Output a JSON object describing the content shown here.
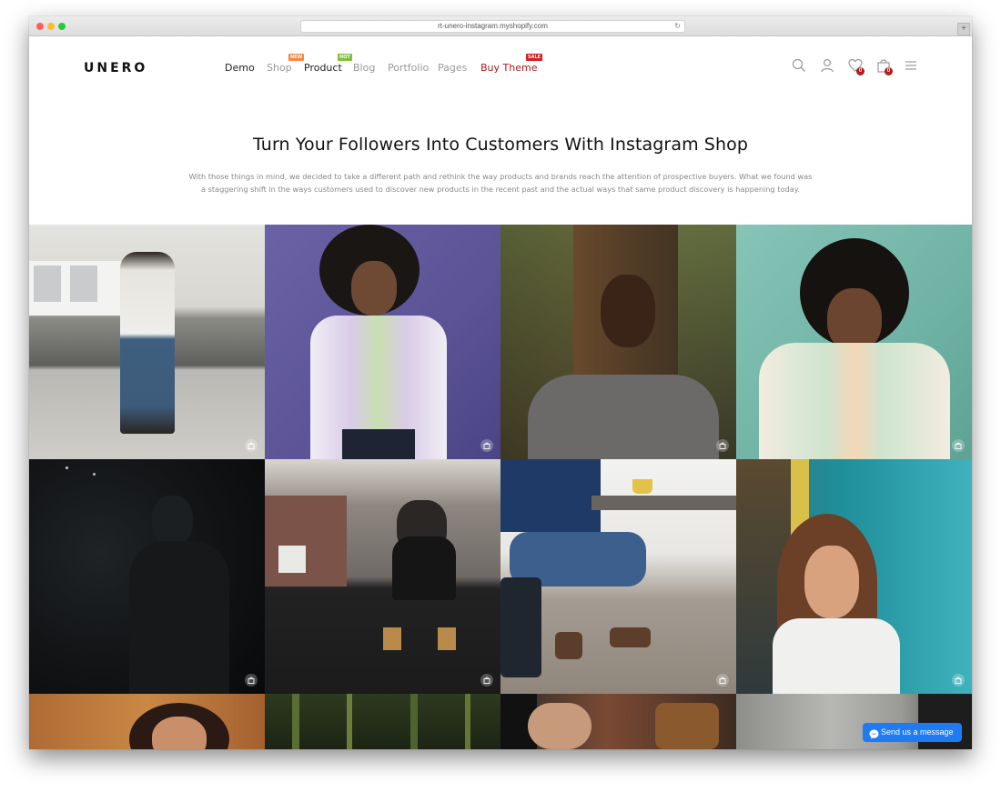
{
  "browser": {
    "url": "rt-unero-instagram.myshopify.com"
  },
  "header": {
    "logo": "UNERO",
    "nav": [
      {
        "label": "Demo"
      },
      {
        "label": "Shop",
        "badge": "NEW"
      },
      {
        "label": "Product",
        "badge": "HOT"
      },
      {
        "label": "Blog"
      },
      {
        "label": "Portfolio"
      },
      {
        "label": "Pages"
      },
      {
        "label": "Buy Theme",
        "badge": "SALE"
      }
    ],
    "wishlist_count": "0",
    "cart_count": "0",
    "icons": [
      "search-icon",
      "account-icon",
      "heart-icon",
      "bag-icon",
      "menu-icon"
    ]
  },
  "hero": {
    "title": "Turn Your Followers Into Customers With Instagram Shop",
    "text": "With those things in mind, we decided to take a different path and rethink the way products and brands reach the attention of prospective buyers. What we found was a staggering shift in the ways customers used to discover new products in the recent past and the actual ways that same product discovery is happening today."
  },
  "gallery": {
    "rows": 3,
    "columns": 4,
    "overlay_icon": "bag-icon"
  },
  "chat": {
    "label": "Send us a message",
    "icon": "messenger-icon"
  },
  "colors": {
    "accent": "#b11b1b",
    "messenger": "#1f7bf2"
  }
}
